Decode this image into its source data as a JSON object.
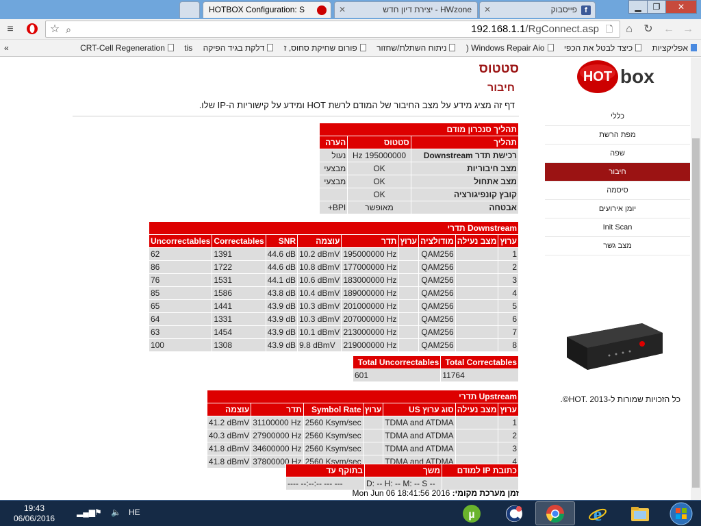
{
  "browser": {
    "tabs": [
      {
        "label": "פייסבוק",
        "state": "inactive"
      },
      {
        "label": "HWzone - יצירת דיון חדש",
        "state": "inactive"
      },
      {
        "label": "HOTBOX Configuration: S",
        "state": "active"
      }
    ],
    "url_host": "192.168.1.1",
    "url_path": "/RgConnect.asp",
    "bookmarks": [
      "אפליקציות",
      "כיצד לבטל את הכפי",
      "Windows Repair Aio (",
      "ניתוח השתלת/שחזור",
      "פורום שחיקת סחוס, ז",
      "דלקת בגיד הפיקה",
      "tis",
      "CRT-Cell Regeneration"
    ]
  },
  "sidebar": {
    "logo_hot": "HOT",
    "logo_box": "box",
    "items": [
      "כללי",
      "מפת הרשת",
      "שפה",
      "חיבור",
      "סיסמה",
      "יומן אירועים",
      "Init Scan",
      "מצב גשר"
    ],
    "selected_index": 3,
    "copyright": "כל הזכויות שמורות ל-HOT. 2013©."
  },
  "page": {
    "title": "סטטוס",
    "subtitle": "חיבור",
    "description": "דף זה מציג מידע על מצב החיבור של המודם לרשת HOT ומידע על קישוריות ה-IP שלו."
  },
  "startup": {
    "caption": "תהליך סנכרון מודם",
    "headers": [
      "תהליך",
      "סטטוס",
      "הערה"
    ],
    "rows": [
      [
        "רכישת תדר Downstream",
        "195000000 Hz",
        "נעול"
      ],
      [
        "מצב חיבוריות",
        "OK",
        "מבצעי"
      ],
      [
        "מצב אתחול",
        "OK",
        "מבצעי"
      ],
      [
        "קובץ קונפיגורציה",
        "OK",
        ""
      ],
      [
        "אבטחה",
        "מאופשר",
        "BPI+"
      ]
    ]
  },
  "downstream": {
    "caption": "Downstream תדרי",
    "headers": [
      "ערוץ",
      "מצב נעילה",
      "מודולציה",
      "ערוץ",
      "תדר",
      "עוצמה",
      "SNR",
      "Correctables",
      "Uncorrectables"
    ],
    "rows": [
      [
        "1",
        "",
        "QAM256",
        "",
        "195000000 Hz",
        "10.2 dBmV",
        "44.6 dB",
        "1391",
        "62"
      ],
      [
        "2",
        "",
        "QAM256",
        "",
        "177000000 Hz",
        "10.8 dBmV",
        "44.6 dB",
        "1722",
        "86"
      ],
      [
        "3",
        "",
        "QAM256",
        "",
        "183000000 Hz",
        "10.6 dBmV",
        "44.1 dB",
        "1531",
        "76"
      ],
      [
        "4",
        "",
        "QAM256",
        "",
        "189000000 Hz",
        "10.4 dBmV",
        "43.8 dB",
        "1586",
        "85"
      ],
      [
        "5",
        "",
        "QAM256",
        "",
        "201000000 Hz",
        "10.3 dBmV",
        "43.9 dB",
        "1441",
        "65"
      ],
      [
        "6",
        "",
        "QAM256",
        "",
        "207000000 Hz",
        "10.3 dBmV",
        "43.9 dB",
        "1331",
        "64"
      ],
      [
        "7",
        "",
        "QAM256",
        "",
        "213000000 Hz",
        "10.1 dBmV",
        "43.9 dB",
        "1454",
        "63"
      ],
      [
        "8",
        "",
        "QAM256",
        "",
        "219000000 Hz",
        "9.8 dBmV",
        "43.9 dB",
        "1308",
        "100"
      ]
    ]
  },
  "totals": {
    "headers": [
      "Total Correctables",
      "Total Uncorrectables"
    ],
    "values": [
      "11764",
      "601"
    ]
  },
  "upstream": {
    "caption": "Upstream תדרי",
    "headers": [
      "ערוץ",
      "מצב נעילה",
      "סוג ערוץ US",
      "ערוץ",
      "Symbol Rate",
      "תדר",
      "עוצמה"
    ],
    "rows": [
      [
        "1",
        "",
        "TDMA and ATDMA",
        "",
        "2560 Ksym/sec",
        "31100000 Hz",
        "41.2 dBmV"
      ],
      [
        "2",
        "",
        "TDMA and ATDMA",
        "",
        "2560 Ksym/sec",
        "27900000 Hz",
        "40.3 dBmV"
      ],
      [
        "3",
        "",
        "TDMA and ATDMA",
        "",
        "2560 Ksym/sec",
        "34600000 Hz",
        "41.8 dBmV"
      ],
      [
        "4",
        "",
        "TDMA and ATDMA",
        "",
        "2560 Ksym/sec",
        "37800000 Hz",
        "41.8 dBmV"
      ]
    ]
  },
  "ip": {
    "headers": [
      "כתובת IP למודם",
      "משך",
      "בתוקף עד"
    ],
    "values": [
      "",
      "D: -- H: -- M: -- S --",
      "---- --:--:-- --- ---"
    ]
  },
  "local_time": {
    "label": "זמן מערכת מקומי:",
    "value": "Mon Jun 06 18:41:56 2016"
  },
  "taskbar": {
    "time": "19:43",
    "date": "06/06/2016",
    "lang": "HE"
  },
  "colors": {
    "accent_red": "#dd0000",
    "nav_selected": "#9b1313",
    "cell_gray": "#dddddd",
    "taskbar": "#152a45"
  }
}
